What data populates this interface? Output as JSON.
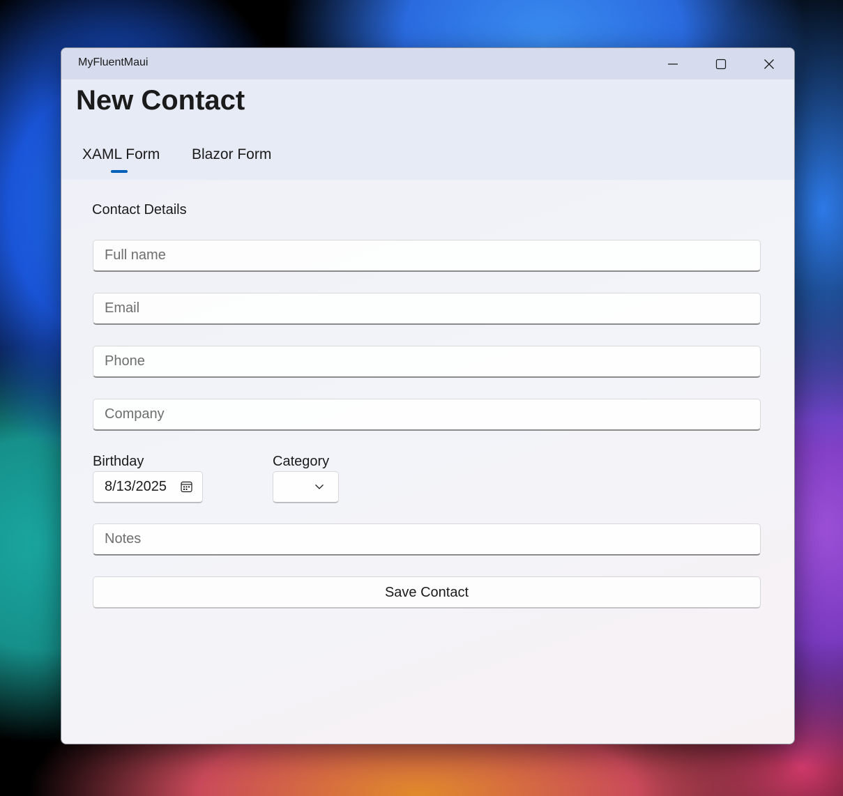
{
  "window": {
    "title": "MyFluentMaui"
  },
  "caption_buttons": {
    "minimize_icon": "minimize-icon",
    "maximize_icon": "maximize-icon",
    "close_icon": "close-icon"
  },
  "page": {
    "title": "New Contact"
  },
  "tabs": [
    {
      "label": "XAML Form",
      "selected": true
    },
    {
      "label": "Blazor Form",
      "selected": false
    }
  ],
  "form": {
    "section_title": "Contact Details",
    "full_name": {
      "value": "",
      "placeholder": "Full name"
    },
    "email": {
      "value": "",
      "placeholder": "Email"
    },
    "phone": {
      "value": "",
      "placeholder": "Phone"
    },
    "company": {
      "value": "",
      "placeholder": "Company"
    },
    "birthday": {
      "label": "Birthday",
      "value": "8/13/2025",
      "icon": "calendar-icon"
    },
    "category": {
      "label": "Category",
      "value": "",
      "icon": "chevron-down-icon"
    },
    "notes": {
      "value": "",
      "placeholder": "Notes"
    },
    "save_label": "Save Contact"
  },
  "colors": {
    "accent": "#005fb8",
    "titlebar": "#d6dcee",
    "header": "#e7ebf5"
  }
}
